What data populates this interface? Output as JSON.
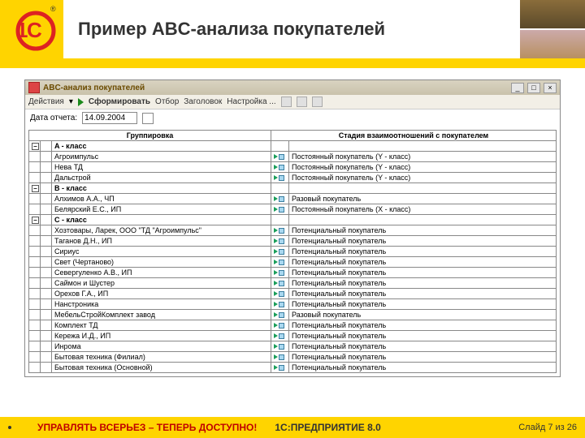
{
  "header": {
    "title": "Пример ABC-анализа покупателей"
  },
  "window": {
    "title": "ABC-анализ покупателей",
    "min": "_",
    "max": "□",
    "close": "×"
  },
  "toolbar": {
    "actions": "Действия",
    "form": "Сформировать",
    "filter": "Отбор",
    "header_btn": "Заголовок",
    "settings": "Настройка ..."
  },
  "filter": {
    "date_label": "Дата отчета:",
    "date_value": "14.09.2004"
  },
  "grid": {
    "col_group": "Группировка",
    "col_stage": "Стадия взаимоотношений с покупателем",
    "minus": "–",
    "groups": [
      {
        "label": "A  - класс",
        "rows": [
          {
            "name": "Агроимпульс",
            "stage": "Постоянный покупатель (Y - класс)"
          },
          {
            "name": "Нева ТД",
            "stage": "Постоянный покупатель (Y - класс)"
          },
          {
            "name": "Дальстрой",
            "stage": "Постоянный покупатель (Y - класс)"
          }
        ]
      },
      {
        "label": "B  - класс",
        "rows": [
          {
            "name": "Алхимов А.А., ЧП",
            "stage": "Разовый покупатель"
          },
          {
            "name": "Белярский Е.С., ИП",
            "stage": "Постоянный покупатель (X - класс)"
          }
        ]
      },
      {
        "label": "C  - класс",
        "rows": [
          {
            "name": "Хозтовары, Ларек, ООО \"ТД \"Агроимпульс\"",
            "stage": "Потенциальный покупатель"
          },
          {
            "name": "Таганов Д.Н., ИП",
            "stage": "Потенциальный покупатель"
          },
          {
            "name": "Сириус",
            "stage": "Потенциальный покупатель"
          },
          {
            "name": "Свет (Чертаново)",
            "stage": "Потенциальный покупатель"
          },
          {
            "name": "Севергуленко А.В., ИП",
            "stage": "Потенциальный покупатель"
          },
          {
            "name": "Саймон и Шустер",
            "stage": "Потенциальный покупатель"
          },
          {
            "name": "Орехов Г.А., ИП",
            "stage": "Потенциальный покупатель"
          },
          {
            "name": "Нанстроника",
            "stage": "Потенциальный покупатель"
          },
          {
            "name": "МебельСтройКомплект завод",
            "stage": "Разовый покупатель"
          },
          {
            "name": "Комплект ТД",
            "stage": "Потенциальный покупатель"
          },
          {
            "name": "Кережа И.Д., ИП",
            "stage": "Потенциальный покупатель"
          },
          {
            "name": "Инрома",
            "stage": "Потенциальный покупатель"
          },
          {
            "name": "Бытовая техника (Филиал)",
            "stage": "Потенциальный покупатель"
          },
          {
            "name": "Бытовая техника (Основной)",
            "stage": "Потенциальный покупатель"
          }
        ]
      }
    ]
  },
  "footer": {
    "slogan": "УПРАВЛЯТЬ ВСЕРЬЕЗ – ТЕПЕРЬ ДОСТУПНО!",
    "product": "1С:ПРЕДПРИЯТИЕ 8.0",
    "slide": "Слайд 7 из 26"
  }
}
